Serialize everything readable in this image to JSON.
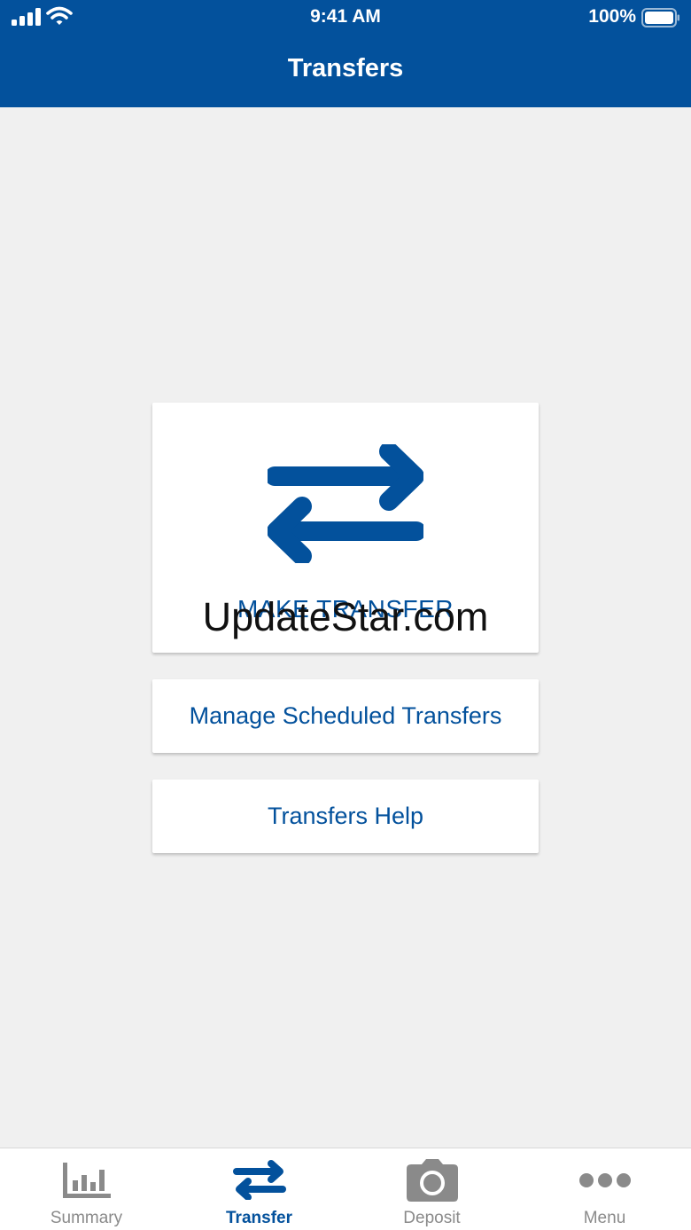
{
  "status_bar": {
    "time": "9:41 AM",
    "battery": "100%",
    "icons": [
      "signal-icon",
      "wifi-icon",
      "battery-icon"
    ]
  },
  "header": {
    "title": "Transfers"
  },
  "cards": {
    "make_transfer": {
      "label": "MAKE TRANSFER",
      "icon": "transfer-arrows-icon"
    },
    "manage_scheduled": {
      "label": "Manage Scheduled Transfers"
    },
    "help": {
      "label": "Transfers Help"
    }
  },
  "watermark": "UpdateStar.com",
  "tabbar": {
    "items": [
      {
        "label": "Summary",
        "icon": "bar-chart-icon",
        "active": false
      },
      {
        "label": "Transfer",
        "icon": "transfer-arrows-icon",
        "active": true
      },
      {
        "label": "Deposit",
        "icon": "camera-icon",
        "active": false
      },
      {
        "label": "Menu",
        "icon": "more-dots-icon",
        "active": false
      }
    ]
  },
  "colors": {
    "brand": "#03519c",
    "background": "#f0f0f0",
    "inactive": "#8a8a8a"
  }
}
